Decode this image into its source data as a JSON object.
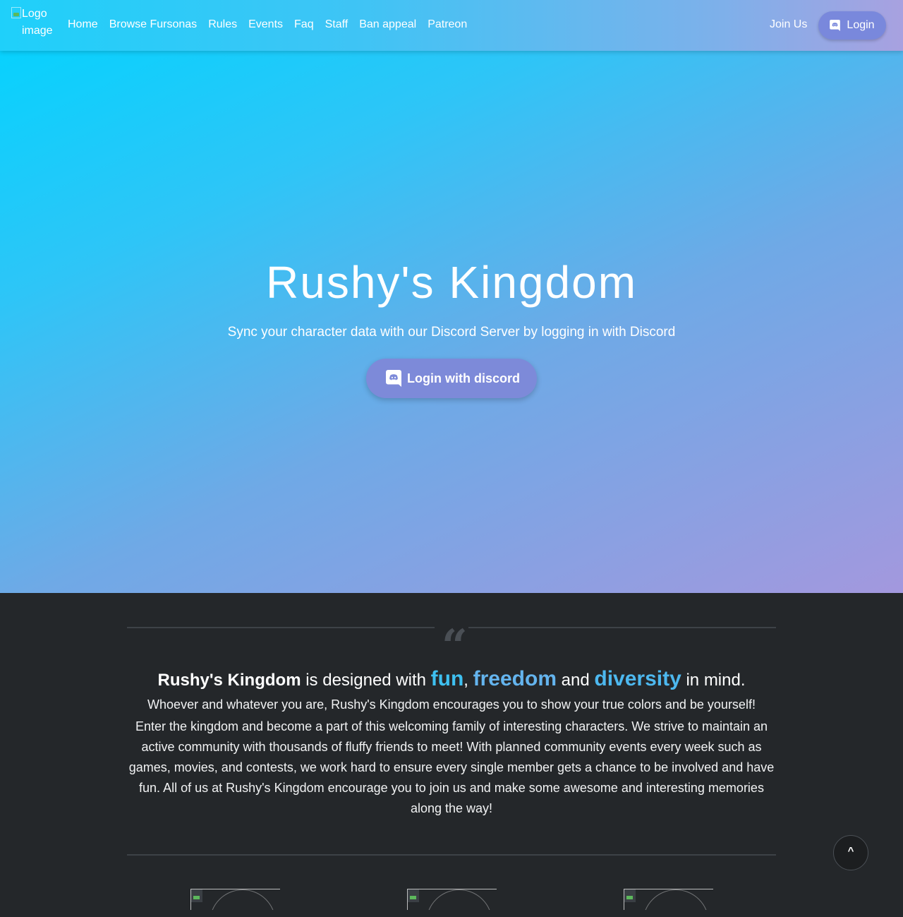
{
  "navbar": {
    "logo_alt": "Logo image",
    "links": [
      "Home",
      "Browse Fursonas",
      "Rules",
      "Events",
      "Faq",
      "Staff",
      "Ban appeal",
      "Patreon"
    ],
    "join_label": "Join Us",
    "login_label": "Login",
    "login_icon": "discord-icon"
  },
  "hero": {
    "title": "Rushy's Kingdom",
    "subtitle": "Sync your character data with our Discord Server by logging in with Discord",
    "button_label": "Login with discord",
    "button_icon": "discord-icon"
  },
  "about": {
    "quote_icon": "quote-icon",
    "brand": "Rushy's Kingdom",
    "headline_mid": " is designed with ",
    "word_fun": "fun",
    "comma": ",",
    "word_freedom": "freedom",
    "and": " and ",
    "word_diversity": "diversity",
    "headline_end": " in mind.",
    "line1": "Whoever and whatever you are, Rushy's Kingdom encourages you to show your true colors and be yourself!",
    "paragraph": "Enter the kingdom and become a part of this welcoming family of interesting characters. We strive to maintain an active community with thousands of fluffy friends to meet! With planned community events every week such as games, movies, and contests, we work hard to ensure every single member gets a chance to be involved and have fun. All of us at Rushy's Kingdom encourage you to join us and make some awesome and interesting memories along the way!"
  },
  "scroll_top_label": "^",
  "colors": {
    "gradient_start": "#00d4ff",
    "gradient_end": "#a398de",
    "discord_button": "#7988dc",
    "highlight": "#3ec0f0",
    "dark_bg": "#24272a"
  }
}
